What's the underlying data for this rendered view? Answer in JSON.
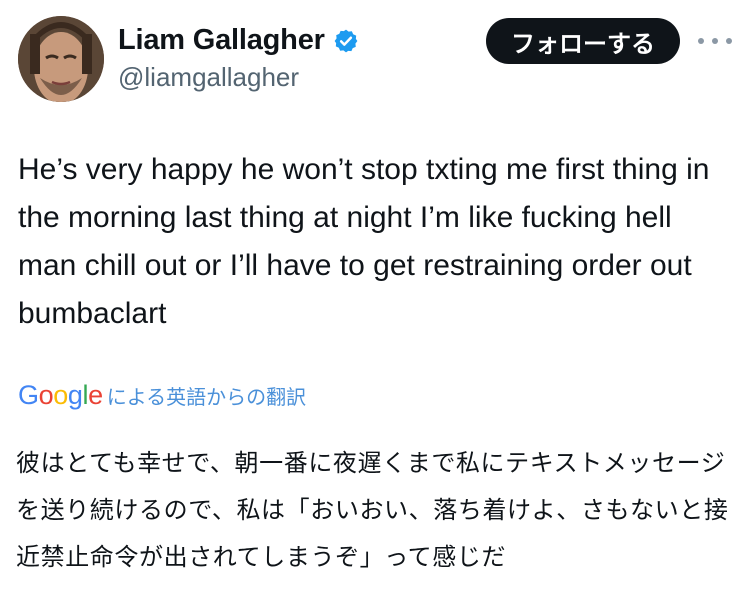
{
  "profile": {
    "display_name": "Liam Gallagher",
    "handle": "@liamgallagher",
    "verified": true
  },
  "header": {
    "follow_label": "フォローする"
  },
  "tweet": {
    "text": "He’s very happy he won’t stop txting me first thing in the morning last thing at night I’m like fucking hell man chill out or I’ll have to get restraining order out bumbaclart"
  },
  "translation": {
    "logo_letters": [
      "G",
      "o",
      "o",
      "g",
      "l",
      "e"
    ],
    "logo_colors": [
      "#4285F4",
      "#EA4335",
      "#FBBC05",
      "#4285F4",
      "#34A853",
      "#EA4335"
    ],
    "label": "による英語からの翻訳",
    "text": "彼はとても幸せで、朝一番に夜遅くまで私にテキストメッセージを送り続けるので、私は「おいおい、落ち着けよ、さもないと接近禁止命令が出されてしまうぞ」って感じだ"
  },
  "colors": {
    "verified_blue": "#1D9BF0",
    "follow_button_bg": "#0F1419",
    "link_blue": "#4A90D9",
    "handle_gray": "#536471"
  },
  "icons": {
    "verified": "verified-badge-icon",
    "more": "more-horizontal-icon"
  }
}
